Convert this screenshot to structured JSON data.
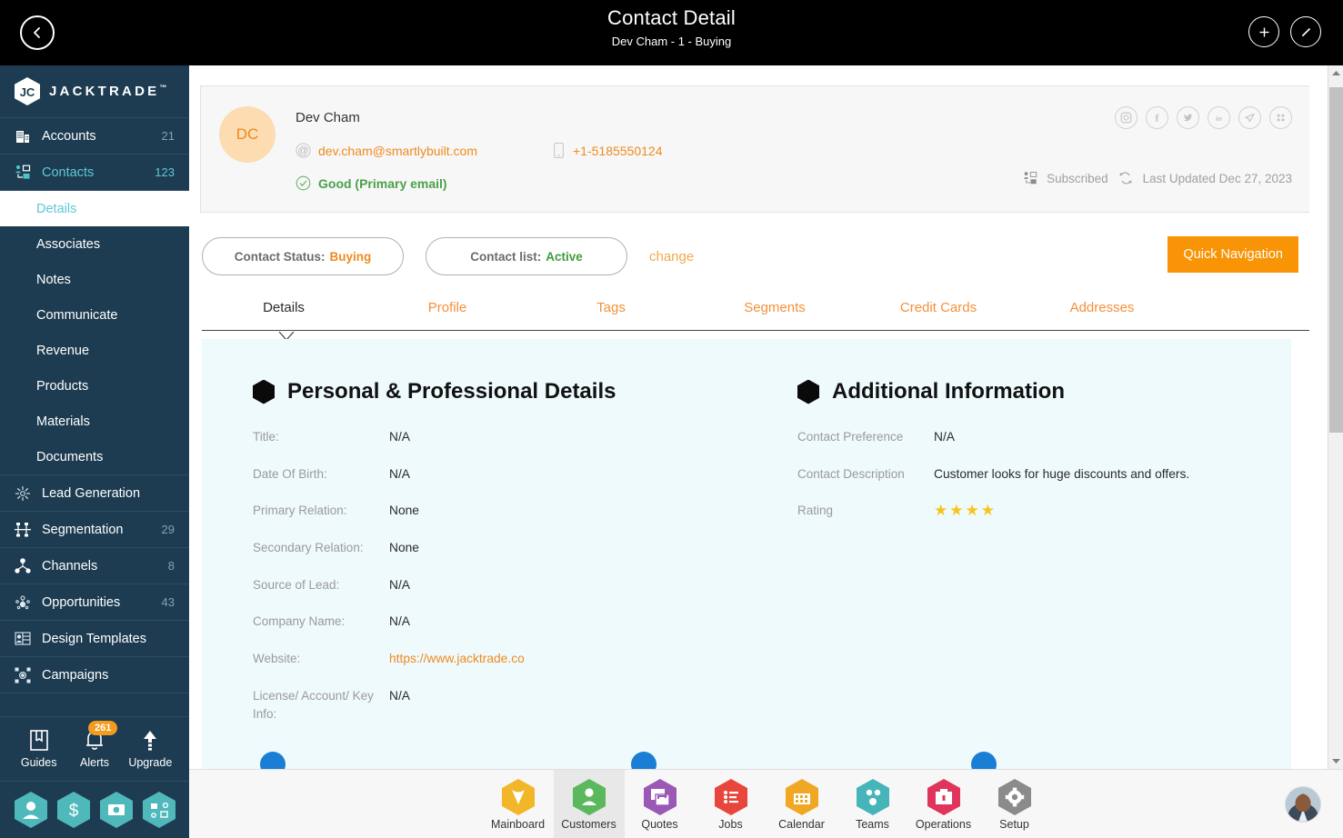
{
  "topbar": {
    "title": "Contact Detail",
    "subtitle": "Dev Cham - 1 - Buying",
    "back_icon": "chevron-left-icon",
    "add_icon": "plus-icon",
    "edit_icon": "pencil-icon"
  },
  "brand": {
    "name": "JACKTRADE",
    "tm": "™"
  },
  "sidebar": {
    "items": [
      {
        "label": "Accounts",
        "count": "21",
        "icon": "building-icon",
        "style": "plain"
      },
      {
        "label": "Contacts",
        "count": "123",
        "icon": "contacts-icon",
        "style": "teal"
      }
    ],
    "subitems": [
      {
        "label": "Details",
        "active": true
      },
      {
        "label": "Associates",
        "active": false
      },
      {
        "label": "Notes",
        "active": false
      },
      {
        "label": "Communicate",
        "active": false
      },
      {
        "label": "Revenue",
        "active": false
      },
      {
        "label": "Products",
        "active": false
      },
      {
        "label": "Materials",
        "active": false
      },
      {
        "label": "Documents",
        "active": false
      }
    ],
    "items2": [
      {
        "label": "Lead Generation",
        "count": "",
        "icon": "lead-generation-icon"
      },
      {
        "label": "Segmentation",
        "count": "29",
        "icon": "segmentation-icon"
      },
      {
        "label": "Channels",
        "count": "8",
        "icon": "channels-icon"
      },
      {
        "label": "Opportunities",
        "count": "43",
        "icon": "opportunities-icon"
      },
      {
        "label": "Design Templates",
        "count": "",
        "icon": "design-templates-icon"
      },
      {
        "label": "Campaigns",
        "count": "",
        "icon": "campaigns-icon"
      }
    ],
    "utilities": [
      {
        "label": "Guides",
        "icon": "book-icon",
        "badge": ""
      },
      {
        "label": "Alerts",
        "icon": "bell-icon",
        "badge": "261"
      },
      {
        "label": "Upgrade",
        "icon": "upload-arrow-icon",
        "badge": ""
      }
    ],
    "hex_shortcuts": [
      {
        "icon": "person-hex-icon"
      },
      {
        "icon": "dollar-hex-icon"
      },
      {
        "icon": "payment-hex-icon"
      },
      {
        "icon": "workflow-hex-icon"
      }
    ]
  },
  "contact_card": {
    "initials": "DC",
    "name": "Dev Cham",
    "email": "dev.cham@smartlybuilt.com",
    "phone": "+1-5185550124",
    "email_status": "Good (Primary email)",
    "subscribed": "Subscribed",
    "last_updated": "Last Updated Dec 27, 2023",
    "socials": [
      {
        "icon": "instagram-icon",
        "glyph": "camera"
      },
      {
        "icon": "facebook-icon",
        "glyph": "f"
      },
      {
        "icon": "twitter-icon",
        "glyph": "bird"
      },
      {
        "icon": "linkedin-icon",
        "glyph": "in"
      },
      {
        "icon": "telegram-icon",
        "glyph": "plane"
      },
      {
        "icon": "apps-grid-icon",
        "glyph": "grid"
      }
    ]
  },
  "status_row": {
    "contact_status_label": "Contact Status:",
    "contact_status_value": "Buying",
    "contact_list_label": "Contact list:",
    "contact_list_value": "Active",
    "change_label": "change",
    "quick_navigation_label": "Quick Navigation"
  },
  "tabs": [
    {
      "label": "Details",
      "active": true
    },
    {
      "label": "Profile",
      "active": false
    },
    {
      "label": "Tags",
      "active": false
    },
    {
      "label": "Segments",
      "active": false
    },
    {
      "label": "Credit Cards",
      "active": false
    },
    {
      "label": "Addresses",
      "active": false
    }
  ],
  "panel": {
    "left": {
      "title": "Personal & Professional Details",
      "fields": [
        {
          "label": "Title:",
          "value": "N/A",
          "link": false
        },
        {
          "label": "Date Of Birth:",
          "value": "N/A",
          "link": false
        },
        {
          "label": "Primary Relation:",
          "value": "None",
          "link": false
        },
        {
          "label": "Secondary Relation:",
          "value": "None",
          "link": false
        },
        {
          "label": "Source of Lead:",
          "value": "N/A",
          "link": false
        },
        {
          "label": "Company Name:",
          "value": "N/A",
          "link": false
        },
        {
          "label": "Website:",
          "value": "https://www.jacktrade.co",
          "link": true
        },
        {
          "label": "License/ Account/ Key Info:",
          "value": "N/A",
          "link": false
        }
      ]
    },
    "right": {
      "title": "Additional Information",
      "fields": [
        {
          "label": "Contact Preference",
          "value": "N/A",
          "link": false
        },
        {
          "label": "Contact Description",
          "value": "Customer looks for huge discounts and offers.",
          "link": false
        }
      ],
      "rating_label": "Rating",
      "rating_stars": "★★★★"
    }
  },
  "dock": [
    {
      "label": "Mainboard",
      "icon": "mainboard-icon",
      "color": "#f2b629",
      "active": false
    },
    {
      "label": "Customers",
      "icon": "customers-icon",
      "color": "#5cb85c",
      "active": true
    },
    {
      "label": "Quotes",
      "icon": "quotes-icon",
      "color": "#9b59b6",
      "active": false
    },
    {
      "label": "Jobs",
      "icon": "jobs-icon",
      "color": "#e8453c",
      "active": false
    },
    {
      "label": "Calendar",
      "icon": "calendar-icon",
      "color": "#f0a723",
      "active": false
    },
    {
      "label": "Teams",
      "icon": "teams-icon",
      "color": "#45b5ba",
      "active": false
    },
    {
      "label": "Operations",
      "icon": "operations-icon",
      "color": "#e0345a",
      "active": false
    },
    {
      "label": "Setup",
      "icon": "setup-icon",
      "color": "#8b8b8b",
      "active": false
    }
  ],
  "colors": {
    "accent_orange": "#f08a1e",
    "sidebar_bg": "#1d3c51",
    "teal": "#5ec8d8",
    "panel_bg": "#effafd",
    "green": "#4ba14b"
  }
}
